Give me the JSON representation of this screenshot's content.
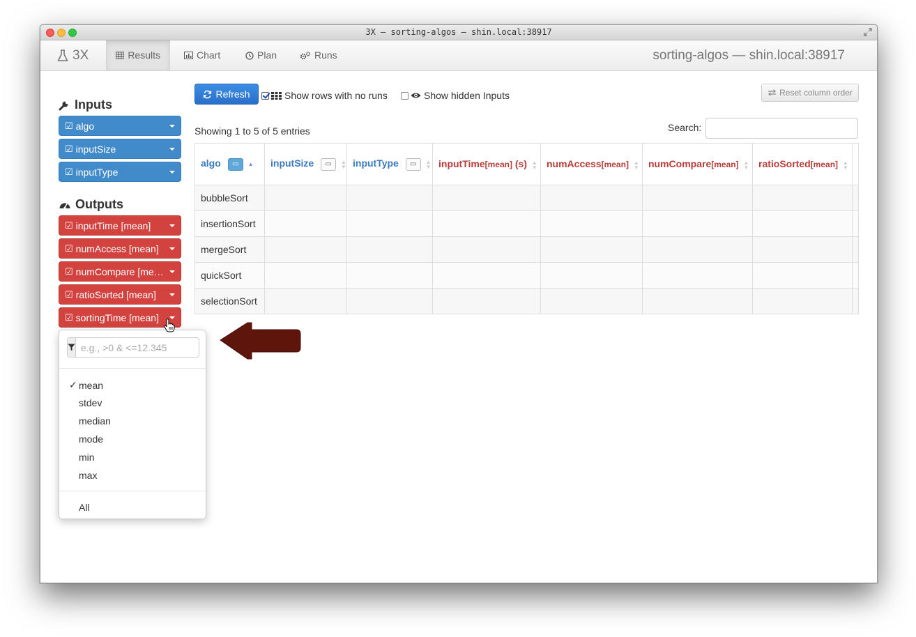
{
  "window": {
    "title": "3X — sorting-algos — shin.local:38917"
  },
  "navbar": {
    "brand": "3X",
    "tabs": [
      {
        "label": "Results",
        "icon": "table-icon",
        "active": true
      },
      {
        "label": "Chart",
        "icon": "bar-chart-icon",
        "active": false
      },
      {
        "label": "Plan",
        "icon": "clock-icon",
        "active": false
      },
      {
        "label": "Runs",
        "icon": "gears-icon",
        "active": false
      }
    ],
    "right_title": "sorting-algos — shin.local:38917"
  },
  "sidebar": {
    "inputs_title": "Inputs",
    "inputs": [
      {
        "label": "algo"
      },
      {
        "label": "inputSize"
      },
      {
        "label": "inputType"
      }
    ],
    "outputs_title": "Outputs",
    "outputs": [
      {
        "label": "inputTime [mean]"
      },
      {
        "label": "numAccess [mean]"
      },
      {
        "label": "numCompare [me…"
      },
      {
        "label": "ratioSorted [mean]"
      },
      {
        "label": "sortingTime [mean]"
      }
    ]
  },
  "toolbar": {
    "refresh_label": "Refresh",
    "show_rows_label": "Show rows with no runs",
    "show_rows_checked": true,
    "show_hidden_label": "Show hidden Inputs",
    "show_hidden_checked": false,
    "reset_label": "Reset column order"
  },
  "table": {
    "info": "Showing 1 to 5 of 5 entries",
    "search_label": "Search:",
    "search_value": "",
    "columns": [
      {
        "name": "algo",
        "agg": "",
        "unit": "",
        "kind": "input"
      },
      {
        "name": "inputSize",
        "agg": "",
        "unit": "",
        "kind": "input"
      },
      {
        "name": "inputType",
        "agg": "",
        "unit": "",
        "kind": "input"
      },
      {
        "name": "inputTime",
        "agg": "[mean]",
        "unit": " (s)",
        "kind": "output"
      },
      {
        "name": "numAccess",
        "agg": "[mean]",
        "unit": "",
        "kind": "output"
      },
      {
        "name": "numCompare",
        "agg": "[mean]",
        "unit": "",
        "kind": "output"
      },
      {
        "name": "ratioSorted",
        "agg": "[mean]",
        "unit": "",
        "kind": "output"
      }
    ],
    "rows": [
      "bubbleSort",
      "insertionSort",
      "mergeSort",
      "quickSort",
      "selectionSort"
    ]
  },
  "popover": {
    "filter_placeholder": "e.g., >0 & <=12.345",
    "filter_value": "",
    "aggregations": [
      {
        "label": "mean",
        "checked": true
      },
      {
        "label": "stdev",
        "checked": false
      },
      {
        "label": "median",
        "checked": false
      },
      {
        "label": "mode",
        "checked": false
      },
      {
        "label": "min",
        "checked": false
      },
      {
        "label": "max",
        "checked": false
      }
    ],
    "all_label": "All",
    "check_mark": "✓"
  },
  "colors": {
    "input_blue": "#428bca",
    "output_red": "#d2433f",
    "arrow": "#5e150b"
  }
}
